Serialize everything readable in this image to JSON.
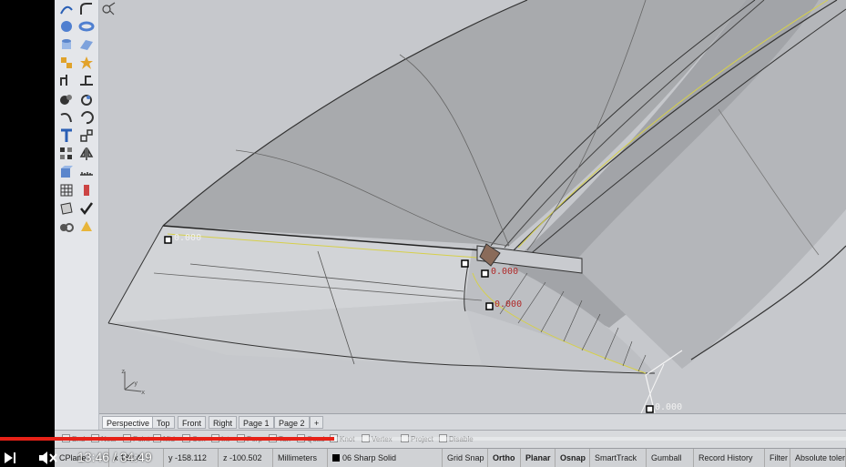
{
  "viewport": {
    "dimensions": [
      "0.000",
      "0.000",
      "0.000",
      "0.000"
    ]
  },
  "viewport_tabs": [
    "Perspective",
    "Top",
    "Front",
    "Right",
    "Page 1",
    "Page 2",
    "+"
  ],
  "osnap": [
    "End",
    "Near",
    "Point",
    "Mid",
    "Cen",
    "Int",
    "Perp",
    "Tan",
    "Quad",
    "Knot",
    "Vertex",
    "Project",
    "Disable"
  ],
  "status": {
    "cplane": "CPlane",
    "x": "x 182.4",
    "y": "y -158.112",
    "z": "z -100.502",
    "units": "Millimeters",
    "layer": "06 Sharp Solid",
    "layer_color": "#000000",
    "toggles": [
      "Grid Snap",
      "Ortho",
      "Planar",
      "Osnap",
      "SmartTrack",
      "Gumball",
      "Record History",
      "Filter",
      "Absolute tolerance"
    ]
  },
  "player": {
    "time": "13:46 / 34:49",
    "progress": 0.395
  },
  "toolbar_icons": [
    "curve-icon",
    "fillet-icon",
    "sphere-icon",
    "torus-icon",
    "cylinder-icon",
    "surface-icon",
    "point-icon",
    "explode-icon",
    "extrude-icon",
    "trim-icon",
    "shade-icon",
    "render-icon",
    "arc-icon",
    "rotate-icon",
    "text-icon",
    "transform-icon",
    "array-icon",
    "mirror-icon",
    "solid-icon",
    "measure-icon",
    "grid-icon",
    "block-icon",
    "layer-icon",
    "check-icon",
    "camera-icon",
    "light-icon"
  ]
}
